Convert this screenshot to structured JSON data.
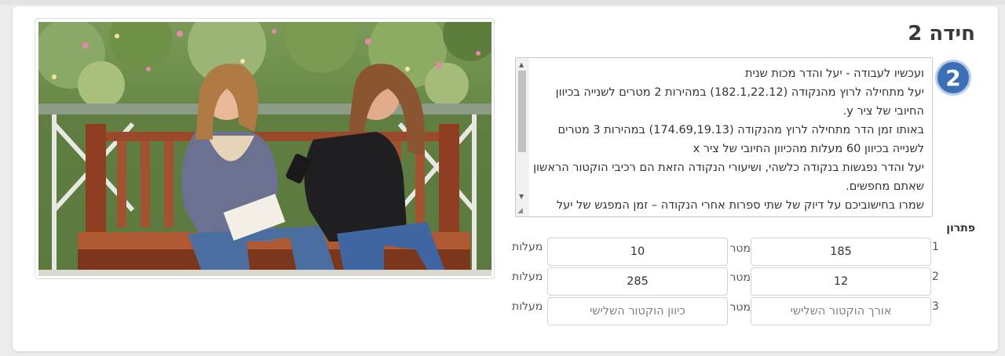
{
  "page": {
    "title": "חידה 2",
    "question_number": "2",
    "problem_lines": [
      "ועכשיו לעבודה - יעל והדר מכות שנית",
      "יעל מתחילה לרוץ מהנקודה (182.1,22.12) במהירות 2 מטרים לשנייה בכיוון החיובי של ציר y.",
      "באותו זמן הדר מתחילה לרוץ מהנקודה (174.69,19.13) במהירות 3 מטרים לשנייה בכיוון 60 מעלות מהכיוון החיובי של ציר x",
      "יעל והדר נפגשות בנקודה כלשהי, ושיעורי הנקודה הזאת הם רכיבי הוקטור הראשון שאתם מחפשים.",
      "שמרו בחישוביכם על דיוק של שתי ספרות אחרי הנקודה – זמן המפגש של יעל"
    ],
    "image_description": "photo of two young women sitting on a wooden bench"
  },
  "solution": {
    "label": "פתרון",
    "rows": [
      {
        "num": "1",
        "length_value": "185",
        "length_placeholder": "",
        "length_unit": "מטר",
        "direction_value": "10",
        "direction_placeholder": "",
        "direction_unit": "מעלות"
      },
      {
        "num": "2",
        "length_value": "12",
        "length_placeholder": "",
        "length_unit": "מטר",
        "direction_value": "285",
        "direction_placeholder": "",
        "direction_unit": "מעלות"
      },
      {
        "num": "3",
        "length_value": "",
        "length_placeholder": "אורך הוקטור השלישי",
        "length_unit": "מטר",
        "direction_value": "",
        "direction_placeholder": "כיוון הוקטור השלישי",
        "direction_unit": "מעלות"
      }
    ]
  },
  "colors": {
    "badge": "#3b70b6",
    "background": "#ececec",
    "card": "#ffffff"
  }
}
